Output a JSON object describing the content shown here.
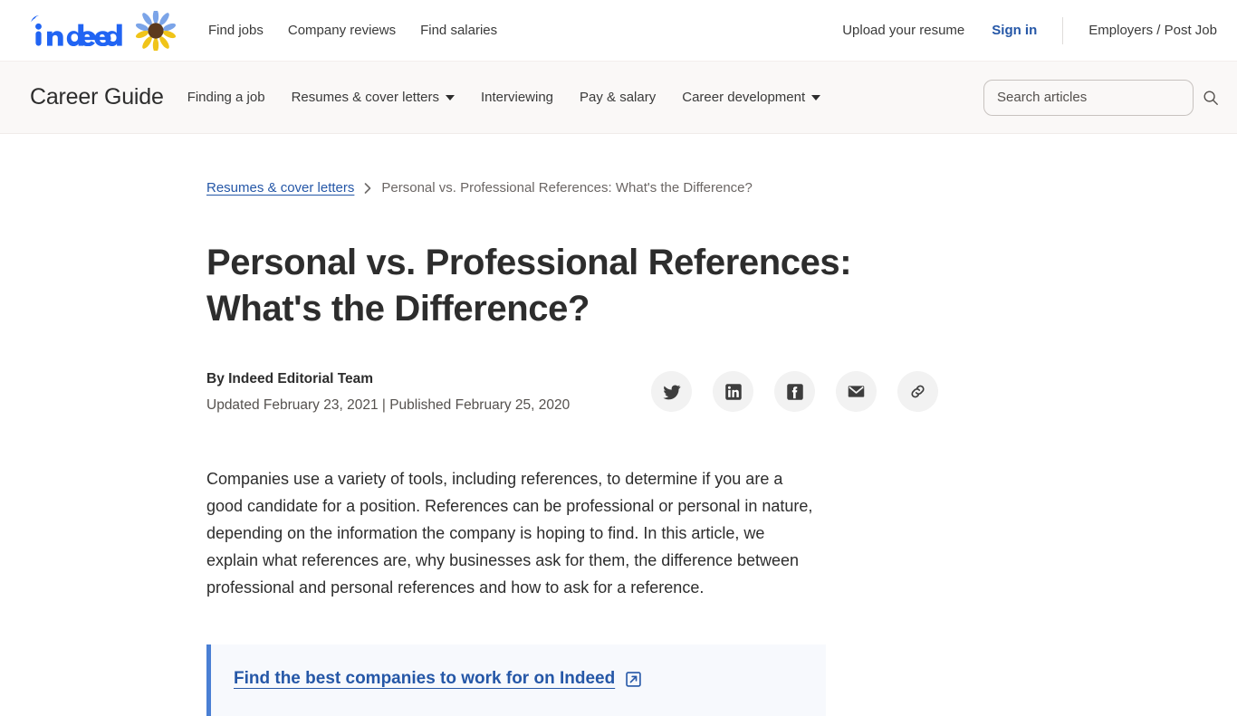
{
  "global_nav": {
    "logo_text": "indeed",
    "logo_color": "#2164f3",
    "sunflower_petal_top_color": "#7ba4e8",
    "sunflower_petal_bottom_color": "#f0c419",
    "sunflower_center_color": "#5c3a1e",
    "links": [
      {
        "label": "Find jobs",
        "name": "find-jobs"
      },
      {
        "label": "Company reviews",
        "name": "company-reviews"
      },
      {
        "label": "Find salaries",
        "name": "find-salaries"
      }
    ],
    "upload_resume": "Upload your resume",
    "sign_in": "Sign in",
    "sign_in_color": "#2557a7",
    "employers": "Employers / Post Job"
  },
  "career_guide": {
    "title": "Career Guide",
    "nav": [
      {
        "label": "Finding a job",
        "has_caret": false,
        "name": "finding-a-job"
      },
      {
        "label": "Resumes & cover letters",
        "has_caret": true,
        "name": "resumes-cover-letters"
      },
      {
        "label": "Interviewing",
        "has_caret": false,
        "name": "interviewing"
      },
      {
        "label": "Pay & salary",
        "has_caret": false,
        "name": "pay-salary"
      },
      {
        "label": "Career development",
        "has_caret": true,
        "name": "career-development"
      }
    ],
    "search": {
      "placeholder": "Search articles",
      "value": "",
      "icon": "search-icon"
    },
    "background_color": "#faf8f7"
  },
  "breadcrumb": {
    "parent_label": "Resumes & cover letters",
    "separator": "chevron-right-icon",
    "current_label": "Personal vs. Professional References: What's the Difference?"
  },
  "article": {
    "title": "Personal vs. Professional References: What's the Difference?",
    "author": "By Indeed Editorial Team",
    "dates": "Updated February 23, 2021 | Published February 25, 2020",
    "share_buttons": [
      {
        "label": "Share on Twitter",
        "icon": "twitter-icon",
        "name": "share-twitter-button"
      },
      {
        "label": "Share on LinkedIn",
        "icon": "linkedin-icon",
        "name": "share-linkedin-button"
      },
      {
        "label": "Share on Facebook",
        "icon": "facebook-icon",
        "name": "share-facebook-button"
      },
      {
        "label": "Share by email",
        "icon": "email-icon",
        "name": "share-email-button"
      },
      {
        "label": "Copy link",
        "icon": "link-icon",
        "name": "share-copy-link-button"
      }
    ],
    "intro_paragraph": "Companies use a variety of tools, including references, to determine if you are a good candidate for a position. References can be professional or personal in nature, depending on the information the company is hoping to find. In this article, we explain what references are, why businesses ask for them, the difference between professional and personal references and how to ask for a reference.",
    "callout": {
      "link_text": "Find the best companies to work for on Indeed",
      "icon": "external-link-icon",
      "accent_color": "#4a7fd4",
      "background_color": "#f7f9fd"
    }
  }
}
